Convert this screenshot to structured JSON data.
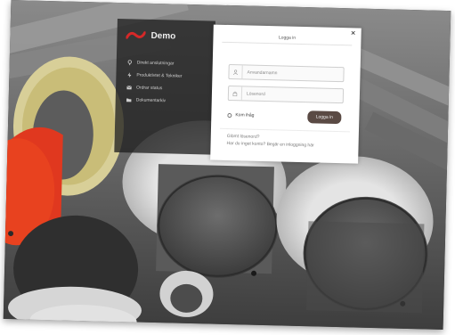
{
  "brand": {
    "name": "Demo",
    "logo": "wave-logo"
  },
  "sidebar": {
    "items": [
      {
        "label": "Direkt anslutningar",
        "icon": "pin-icon"
      },
      {
        "label": "Produktivtet & Tekniker",
        "icon": "bolt-icon"
      },
      {
        "label": "Ordrar status",
        "icon": "mail-icon"
      },
      {
        "label": "Dokumentarkiv",
        "icon": "folder-icon"
      }
    ]
  },
  "login": {
    "title": "Logga in",
    "username_placeholder": "Anvandarnamn",
    "password_placeholder": "Lösenord",
    "remember_label": "Kom ihåg",
    "login_button": "Logga in",
    "forgot_link": "Glömt lösenord?",
    "request_link": "Har du inget konto? Begär en inloggning här"
  },
  "colors": {
    "accent_red": "#d62828",
    "button": "#5a4a44",
    "sidebar_bg": "#202020"
  }
}
